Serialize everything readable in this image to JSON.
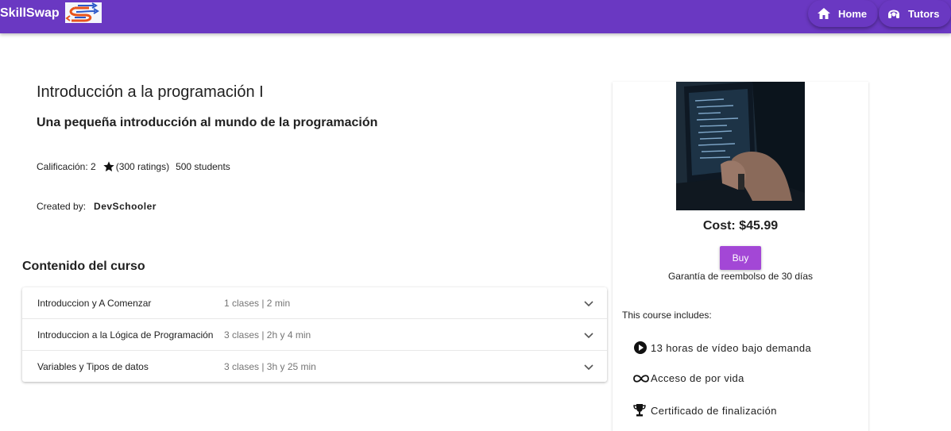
{
  "app": {
    "brand": "SkillSwap"
  },
  "nav": {
    "home": "Home",
    "tutors": "Tutors"
  },
  "course": {
    "title": "Introducción a la programación I",
    "subtitle": "Una pequeña introducción al mundo de la programación",
    "rating_label": "Calificación: 2",
    "ratings": "(300 ratings)",
    "students": "500 students",
    "created_by_label": "Created by:",
    "creator": "DevSchooler"
  },
  "content": {
    "title": "Contenido del curso",
    "sections": [
      {
        "title": "Introduccion y A Comenzar",
        "meta": "1 clases | 2 min"
      },
      {
        "title": "Introduccion a la Lógica de Programación",
        "meta": "3 clases | 2h y 4 min"
      },
      {
        "title": "Variables y Tipos de datos",
        "meta": "3 clases | 3h y 25 min"
      }
    ]
  },
  "purchase": {
    "cost": "Cost: $45.99",
    "buy": "Buy",
    "guarantee": "Garantía de reembolso de 30 días",
    "includes_title": "This course includes:",
    "includes": [
      {
        "icon": "play-circle-icon",
        "text": "13 horas de vídeo bajo demanda"
      },
      {
        "icon": "infinity-icon",
        "text": "Acceso de por vida"
      },
      {
        "icon": "trophy-icon",
        "text": "Certificado de finalización"
      }
    ]
  },
  "colors": {
    "primary": "#6a38c2",
    "buy": "#a347d6"
  }
}
